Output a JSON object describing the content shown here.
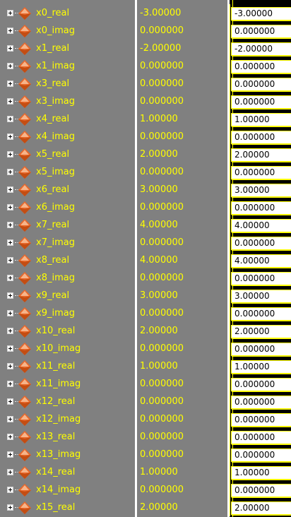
{
  "signals": [
    {
      "name": "x0_real",
      "value": "-3.00000",
      "wave_value": "-3.00000"
    },
    {
      "name": "x0_imag",
      "value": "0.000000",
      "wave_value": "0.000000"
    },
    {
      "name": "x1_real",
      "value": "-2.00000",
      "wave_value": "-2.00000"
    },
    {
      "name": "x1_imag",
      "value": "0.000000",
      "wave_value": "0.000000"
    },
    {
      "name": "x3_real",
      "value": "0.000000",
      "wave_value": "0.000000"
    },
    {
      "name": "x3_imag",
      "value": "0.000000",
      "wave_value": "0.000000"
    },
    {
      "name": "x4_real",
      "value": "1.00000",
      "wave_value": "1.00000"
    },
    {
      "name": "x4_imag",
      "value": "0.000000",
      "wave_value": "0.000000"
    },
    {
      "name": "x5_real",
      "value": "2.00000",
      "wave_value": "2.00000"
    },
    {
      "name": "x5_imag",
      "value": "0.000000",
      "wave_value": "0.000000"
    },
    {
      "name": "x6_real",
      "value": "3.00000",
      "wave_value": "3.00000"
    },
    {
      "name": "x6_imag",
      "value": "0.000000",
      "wave_value": "0.000000"
    },
    {
      "name": "x7_real",
      "value": "4.00000",
      "wave_value": "4.00000"
    },
    {
      "name": "x7_imag",
      "value": "0.000000",
      "wave_value": "0.000000"
    },
    {
      "name": "x8_real",
      "value": "4.00000",
      "wave_value": "4.00000"
    },
    {
      "name": "x8_imag",
      "value": "0.000000",
      "wave_value": "0.000000"
    },
    {
      "name": "x9_real",
      "value": "3.00000",
      "wave_value": "3.00000"
    },
    {
      "name": "x9_imag",
      "value": "0.000000",
      "wave_value": "0.000000"
    },
    {
      "name": "x10_real",
      "value": "2.00000",
      "wave_value": "2.00000"
    },
    {
      "name": "x10_imag",
      "value": "0.000000",
      "wave_value": "0.000000"
    },
    {
      "name": "x11_real",
      "value": "1.00000",
      "wave_value": "1.00000"
    },
    {
      "name": "x11_imag",
      "value": "0.000000",
      "wave_value": "0.000000"
    },
    {
      "name": "x12_real",
      "value": "0.000000",
      "wave_value": "0.000000"
    },
    {
      "name": "x12_imag",
      "value": "0.000000",
      "wave_value": "0.000000"
    },
    {
      "name": "x13_real",
      "value": "0.000000",
      "wave_value": "0.000000"
    },
    {
      "name": "x13_imag",
      "value": "0.000000",
      "wave_value": "0.000000"
    },
    {
      "name": "x14_real",
      "value": "1.00000",
      "wave_value": "1.00000"
    },
    {
      "name": "x14_imag",
      "value": "0.000000",
      "wave_value": "0.000000"
    },
    {
      "name": "x15_real",
      "value": "2.00000",
      "wave_value": "2.00000"
    }
  ],
  "icons": {
    "expander": "expand-plus-icon",
    "signal": "analog-signal-icon"
  },
  "colors": {
    "signal_text": "#ffff00",
    "panel_bg": "#808080",
    "wave_bg": "#000000",
    "icon_primary": "#e8672a",
    "icon_highlight": "#f6b48a"
  }
}
